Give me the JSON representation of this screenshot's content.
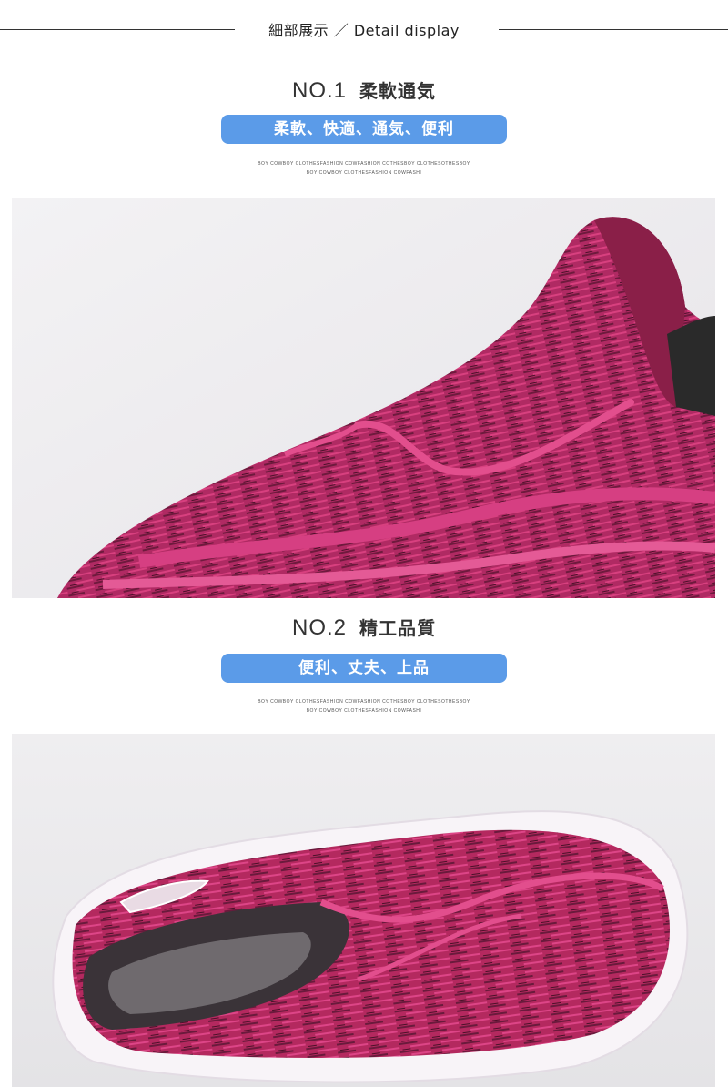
{
  "header": {
    "title": "細部展示 ／ Detail display"
  },
  "sections": [
    {
      "number": "NO.1",
      "name": "柔軟通気",
      "pill": "柔軟、快適、通気、便利",
      "tiny_line1": "BOY COWBOY CLOTHESFASHION COWFASHION COTHESBOY CLOTHESOTHESBOY",
      "tiny_line2": "BOY COWBOY CLOTHESFASHION COWFASHI"
    },
    {
      "number": "NO.2",
      "name": "精工品質",
      "pill": "便利、丈夫、上品",
      "tiny_line1": "BOY COWBOY CLOTHESFASHION COWFASHION COTHESBOY CLOTHESOTHESBOY",
      "tiny_line2": "BOY COWBOY CLOTHESFASHION COWFASHI"
    }
  ],
  "colors": {
    "pill_bg": "#5b9be8",
    "shoe_base": "#b02a63",
    "shoe_accent": "#e0508e",
    "photo_bg": "#f0eff1"
  }
}
